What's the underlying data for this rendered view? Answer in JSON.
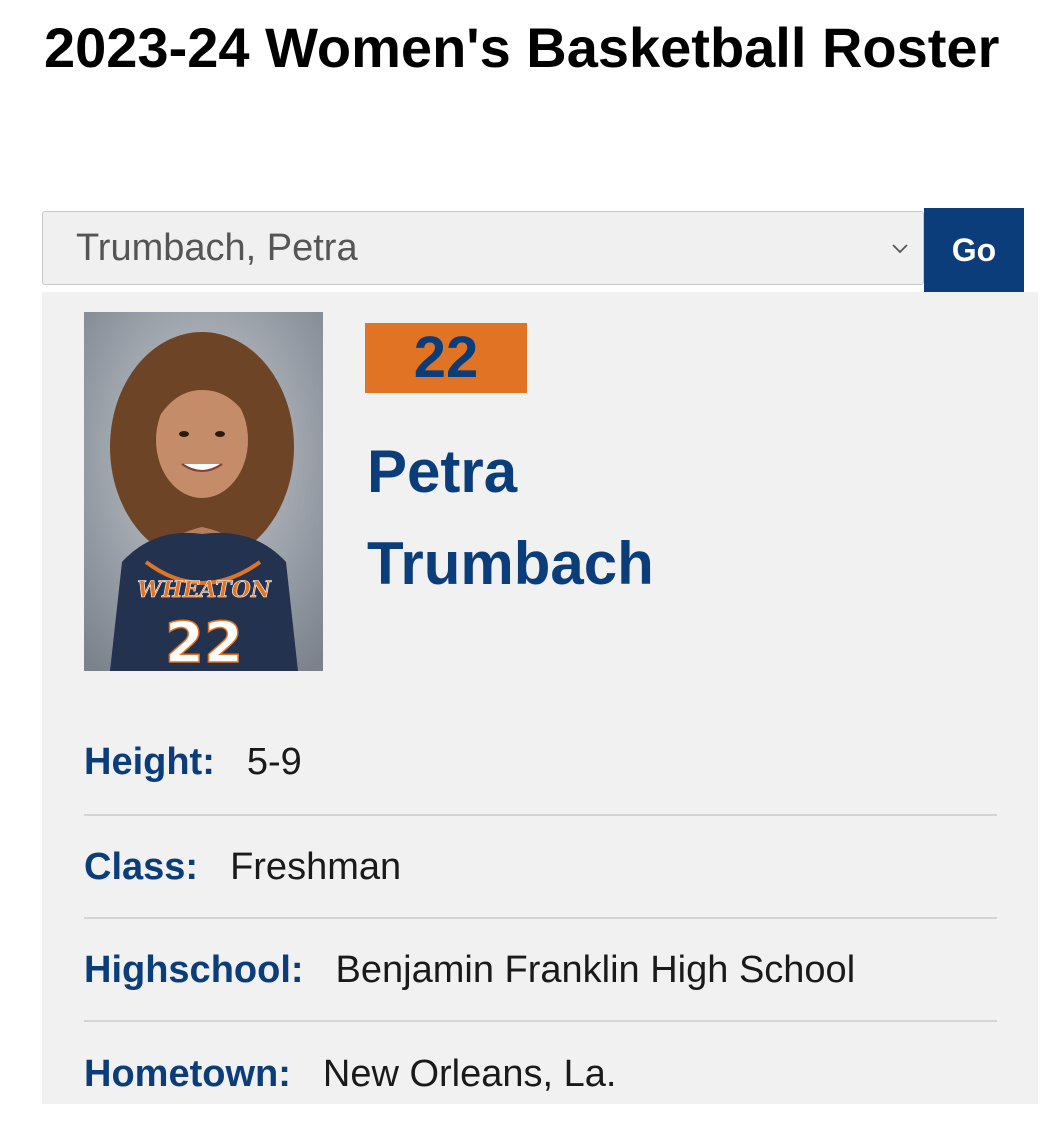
{
  "page": {
    "title": "2023-24 Women's Basketball Roster"
  },
  "selector": {
    "selected_player": "Trumbach, Petra",
    "go_label": "Go"
  },
  "player": {
    "number": "22",
    "first_name": "Petra",
    "last_name": "Trumbach",
    "photo": {
      "jersey_text": "WHEATON",
      "jersey_number": "22"
    }
  },
  "details": {
    "height": {
      "label": "Height:",
      "value": "5-9"
    },
    "class": {
      "label": "Class:",
      "value": "Freshman"
    },
    "highschool": {
      "label": "Highschool:",
      "value": "Benjamin Franklin High School"
    },
    "hometown": {
      "label": "Hometown:",
      "value": "New Orleans, La."
    }
  },
  "colors": {
    "brand_navy": "#0b3d7a",
    "brand_orange": "#e07424",
    "card_background": "#f1f1f1"
  }
}
